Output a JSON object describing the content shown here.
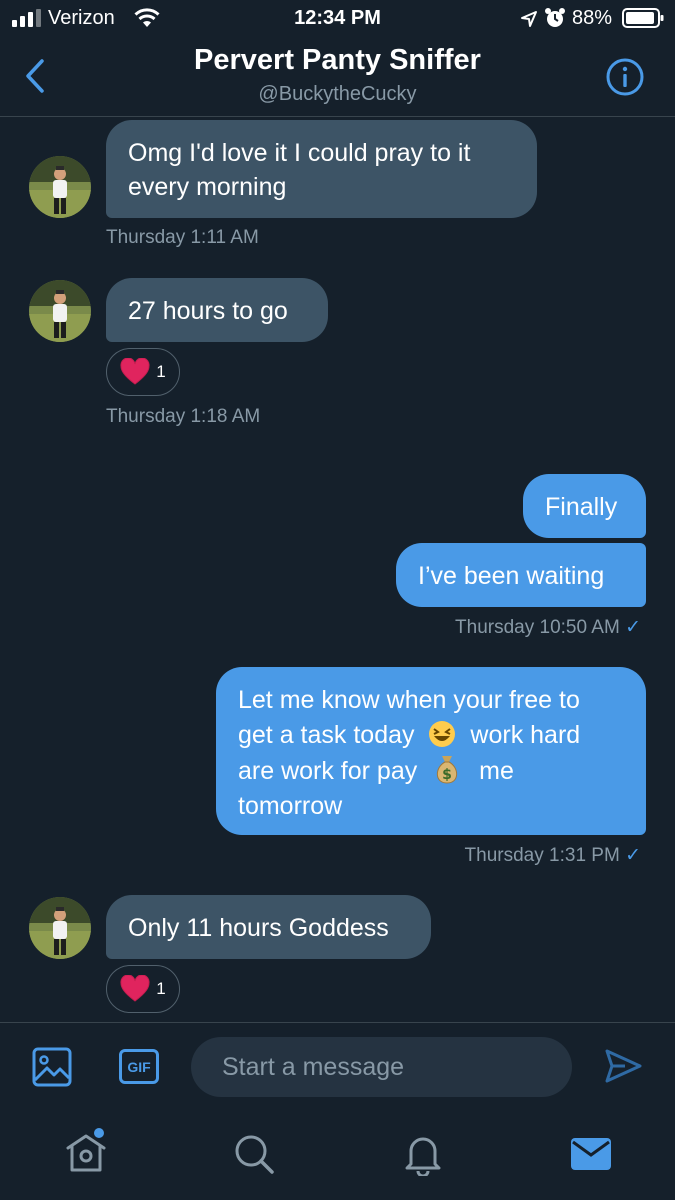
{
  "status_bar": {
    "carrier": "Verizon",
    "time": "12:34 PM",
    "battery": "88%"
  },
  "header": {
    "title": "Pervert Panty Sniffer",
    "handle": "@BuckytheCucky"
  },
  "messages": [
    {
      "direction": "in",
      "text_lines": [
        "Omg I'd love it I could pray to it",
        "every morning"
      ],
      "timestamp": "Thursday 1:11 AM"
    },
    {
      "direction": "in",
      "text": "27 hours to go",
      "reaction": {
        "emoji": "heart",
        "count": "1"
      },
      "timestamp": "Thursday 1:18 AM"
    },
    {
      "direction": "out",
      "text": "Finally"
    },
    {
      "direction": "out",
      "text": "I’ve been waiting",
      "timestamp": "Thursday 10:50 AM"
    },
    {
      "direction": "out",
      "text_lines": [
        "Let me know when your free to",
        "get a task today",
        "work hard",
        "are work for pay",
        "me",
        "tomorrow"
      ],
      "timestamp": "Thursday 1:31 PM"
    },
    {
      "direction": "in",
      "text": "Only 11 hours Goddess",
      "reaction": {
        "emoji": "heart",
        "count": "1"
      }
    }
  ],
  "compose": {
    "placeholder": "Start a message",
    "gif_label": "GIF"
  },
  "colors": {
    "background": "#15202b",
    "accent": "#4a9ae7",
    "incoming_bubble": "#3d5466",
    "secondary_text": "#8899a6"
  },
  "icons": [
    "back-chevron-icon",
    "info-icon",
    "image-icon",
    "gif-icon",
    "send-icon",
    "home-icon",
    "search-icon",
    "bell-icon",
    "mail-icon"
  ]
}
